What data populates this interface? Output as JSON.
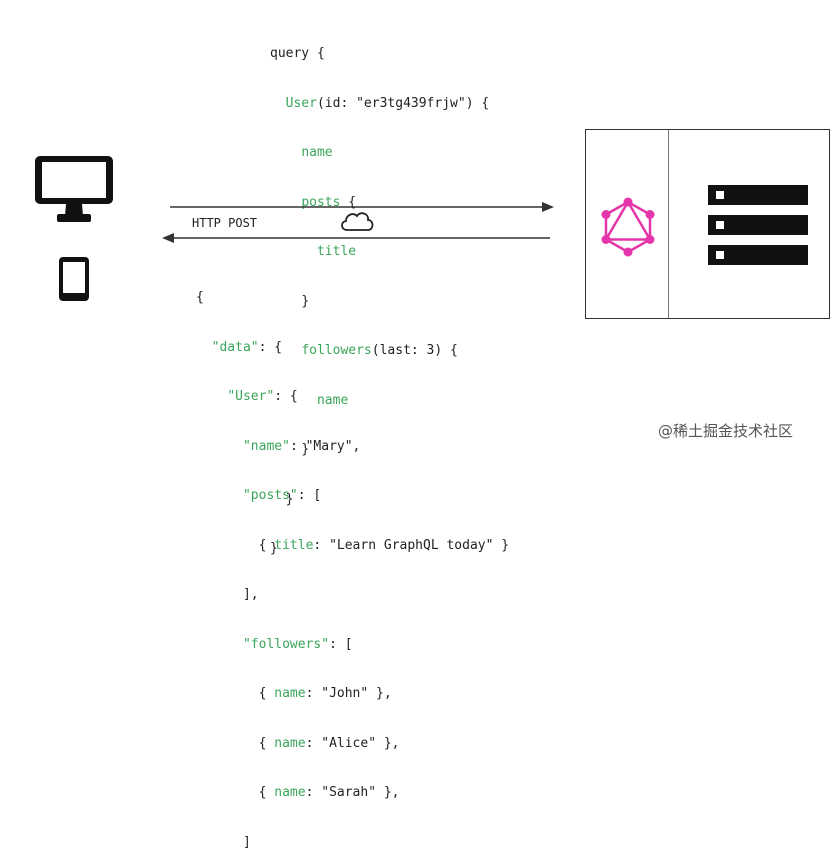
{
  "query": {
    "line1": "query {",
    "user_field": "User",
    "user_args_open": "(id: ",
    "user_id": "\"er3tg439frjw\"",
    "user_args_close": ") {",
    "name": "name",
    "posts": "posts",
    "brace_open": " {",
    "title": "title",
    "brace_close": "}",
    "followers": "followers",
    "followers_args": "(last: 3) {",
    "name2": "name"
  },
  "transport": {
    "label": "HTTP POST"
  },
  "response": {
    "open": "{",
    "data_key": "\"data\"",
    "user_key": "\"User\"",
    "name_key": "\"name\"",
    "name_value": "\"Mary\",",
    "posts_key": "\"posts\"",
    "posts_open": ": [",
    "post_item_open": "{ ",
    "title_key": "title",
    "title_value": ": \"Learn GraphQL today\" }",
    "posts_close": "],",
    "followers_key": "\"followers\"",
    "followers_open": ": [",
    "f1_key": "name",
    "f1_value": ": \"John\" },",
    "f2_key": "name",
    "f2_value": ": \"Alice\" },",
    "f3_key": "name",
    "f3_value": ": \"Sarah\" },",
    "followers_close": "]"
  },
  "watermark": "@稀土掘金技术社区",
  "colors": {
    "field_green": "#3aa55a",
    "graphql_magenta": "#e535ab",
    "device_black": "#111111"
  },
  "icons": [
    "monitor-icon",
    "phone-icon",
    "cloud-icon",
    "graphql-logo-icon",
    "server-rack-icon"
  ]
}
